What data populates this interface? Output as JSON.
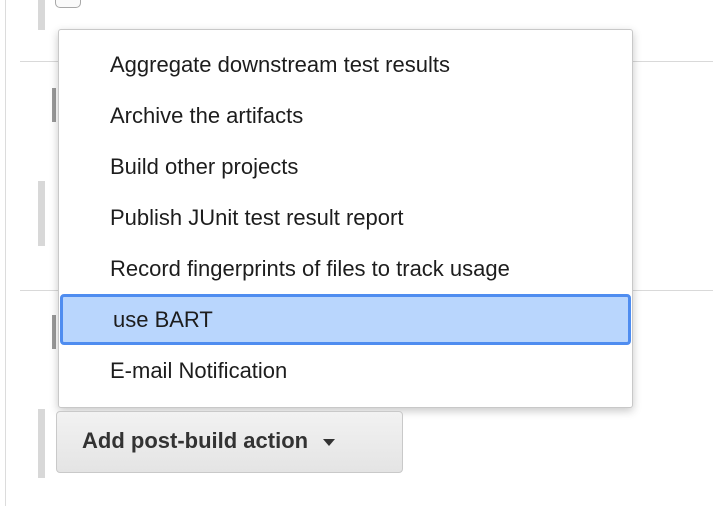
{
  "menu": {
    "items": [
      {
        "label": "Aggregate downstream test results"
      },
      {
        "label": "Archive the artifacts"
      },
      {
        "label": "Build other projects"
      },
      {
        "label": "Publish JUnit test result report"
      },
      {
        "label": "Record fingerprints of files to track usage"
      },
      {
        "label": "use BART",
        "selected": true
      },
      {
        "label": "E-mail Notification"
      }
    ]
  },
  "post_build": {
    "button_label": "Add post-build action"
  },
  "icons": {
    "dropdown_caret": "caret-down-icon"
  },
  "colors": {
    "selection_background": "#b9d6fd",
    "selection_border": "#4f8df0",
    "button_background": "#e9e9e9"
  }
}
